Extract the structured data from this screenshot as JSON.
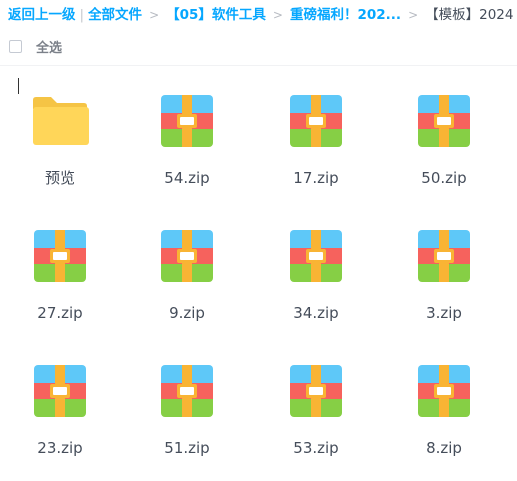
{
  "breadcrumb": {
    "back_label": "返回上一级",
    "items": [
      {
        "label": "全部文件"
      },
      {
        "label": "【05】软件工具"
      },
      {
        "label": "重磅福利！202..."
      },
      {
        "label": "【模板】2024..."
      }
    ],
    "separator": ">"
  },
  "toolbar": {
    "select_all_label": "全选"
  },
  "files": [
    {
      "name": "预览",
      "type": "folder",
      "icon": "folder-icon"
    },
    {
      "name": "54.zip",
      "type": "zip",
      "icon": "zip-archive-icon"
    },
    {
      "name": "17.zip",
      "type": "zip",
      "icon": "zip-archive-icon"
    },
    {
      "name": "50.zip",
      "type": "zip",
      "icon": "zip-archive-icon"
    },
    {
      "name": "27.zip",
      "type": "zip",
      "icon": "zip-archive-icon"
    },
    {
      "name": "9.zip",
      "type": "zip",
      "icon": "zip-archive-icon"
    },
    {
      "name": "34.zip",
      "type": "zip",
      "icon": "zip-archive-icon"
    },
    {
      "name": "3.zip",
      "type": "zip",
      "icon": "zip-archive-icon"
    },
    {
      "name": "23.zip",
      "type": "zip",
      "icon": "zip-archive-icon"
    },
    {
      "name": "51.zip",
      "type": "zip",
      "icon": "zip-archive-icon"
    },
    {
      "name": "53.zip",
      "type": "zip",
      "icon": "zip-archive-icon"
    },
    {
      "name": "8.zip",
      "type": "zip",
      "icon": "zip-archive-icon"
    }
  ],
  "colors": {
    "link": "#06a7ff",
    "text": "#454d5a",
    "folder": "#ffd659",
    "folder_tab": "#f5c445",
    "zip_top": "#5ec8f8",
    "zip_middle": "#f6625d",
    "zip_bottom": "#86cf45",
    "zip_strap": "#f9b434"
  }
}
